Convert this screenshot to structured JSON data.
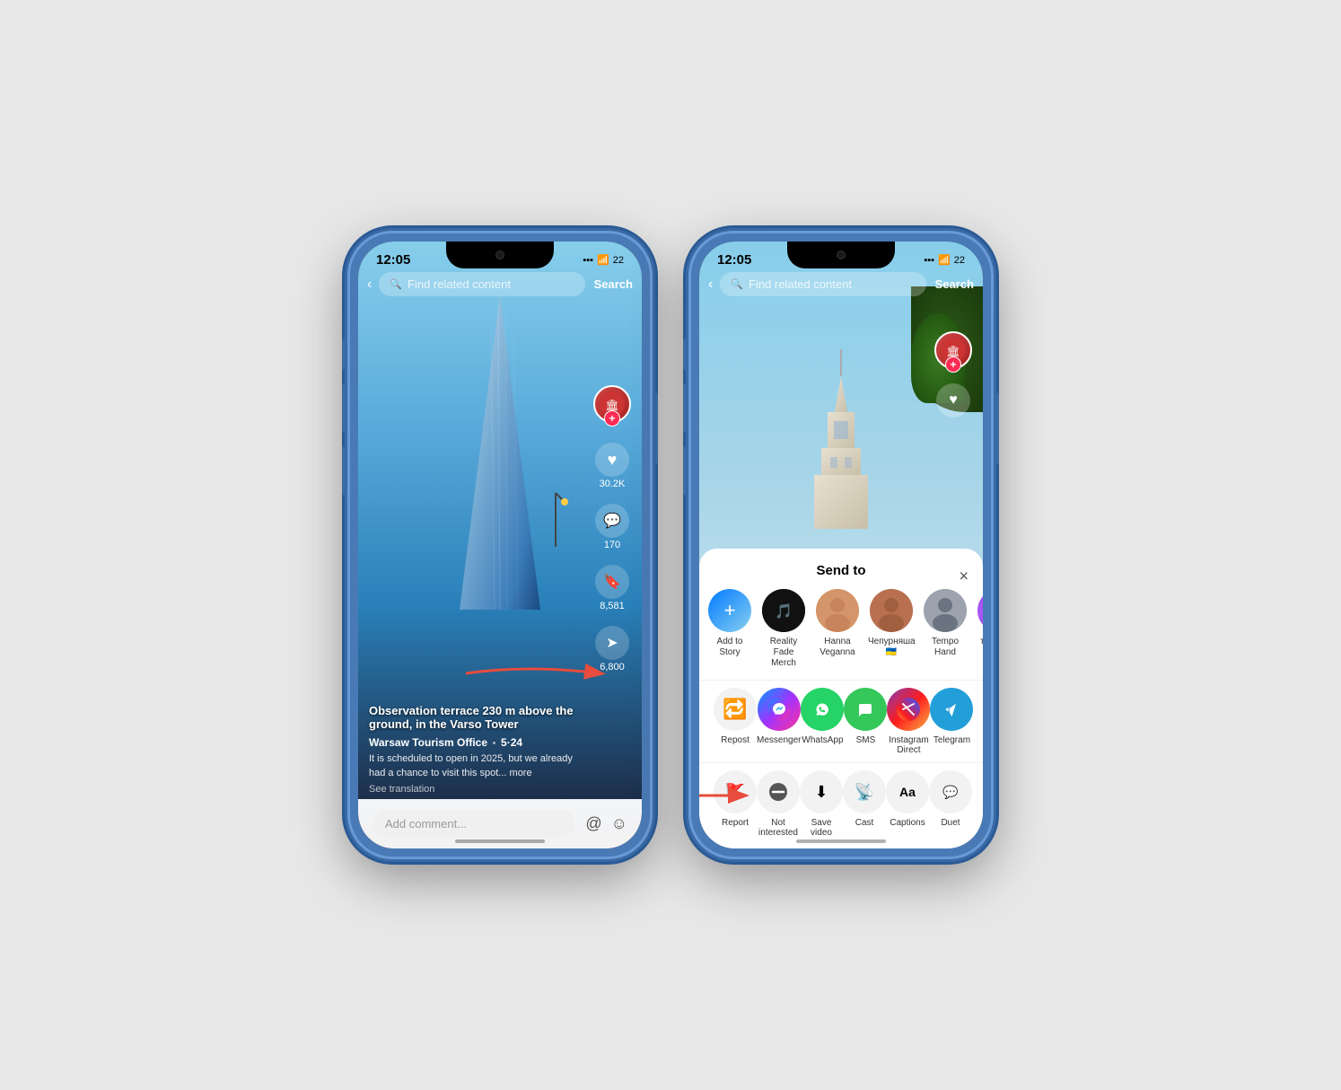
{
  "phones": {
    "phone1": {
      "time": "12:05",
      "battery": "22",
      "search_placeholder": "Find related content",
      "search_btn": "Search",
      "video_title": "Observation terrace 230 m above\nthe ground, in the Varso Tower",
      "user": "Warsaw Tourism Office",
      "date": "5·24",
      "likes": "30.2K",
      "comments": "170",
      "saves": "8,581",
      "shares": "6,800",
      "description": "It is scheduled to open in 2025, but we already had a chance to visit this spot... more",
      "see_translation": "See translation",
      "comment_placeholder": "Add comment..."
    },
    "phone2": {
      "time": "12:05",
      "battery": "22",
      "search_placeholder": "Find related content",
      "search_btn": "Search",
      "sheet_title": "Send to",
      "close_btn": "×",
      "contacts": [
        {
          "name": "Add to Story",
          "emoji": "➕",
          "bg": "story"
        },
        {
          "name": "Reality Fade Merch",
          "emoji": "🎵",
          "bg": "reality"
        },
        {
          "name": "Hanna Veganna",
          "emoji": "👩",
          "bg": "hanna"
        },
        {
          "name": "Чепурняша 🇺🇦",
          "emoji": "👩",
          "bg": "chep"
        },
        {
          "name": "Tempo Hand",
          "emoji": "👤",
          "bg": "tempo"
        },
        {
          "name": "торнві і її пріколи",
          "emoji": "👩",
          "bg": "tornvi"
        }
      ],
      "apps": [
        {
          "name": "Repost",
          "icon": "🔁",
          "bg": "repost"
        },
        {
          "name": "Messenger",
          "icon": "💬",
          "bg": "messenger"
        },
        {
          "name": "WhatsApp",
          "icon": "📱",
          "bg": "whatsapp"
        },
        {
          "name": "SMS",
          "icon": "💬",
          "bg": "sms"
        },
        {
          "name": "Instagram Direct",
          "icon": "✈️",
          "bg": "instagram"
        },
        {
          "name": "Telegram",
          "icon": "✈️",
          "bg": "telegram"
        }
      ],
      "actions": [
        {
          "name": "Report",
          "icon": "🚩"
        },
        {
          "name": "Not interested",
          "icon": "🚫"
        },
        {
          "name": "Save video",
          "icon": "⬇"
        },
        {
          "name": "Cast",
          "icon": "📡"
        },
        {
          "name": "Captions",
          "icon": "Aa"
        },
        {
          "name": "Duet",
          "icon": "💬"
        }
      ]
    }
  }
}
